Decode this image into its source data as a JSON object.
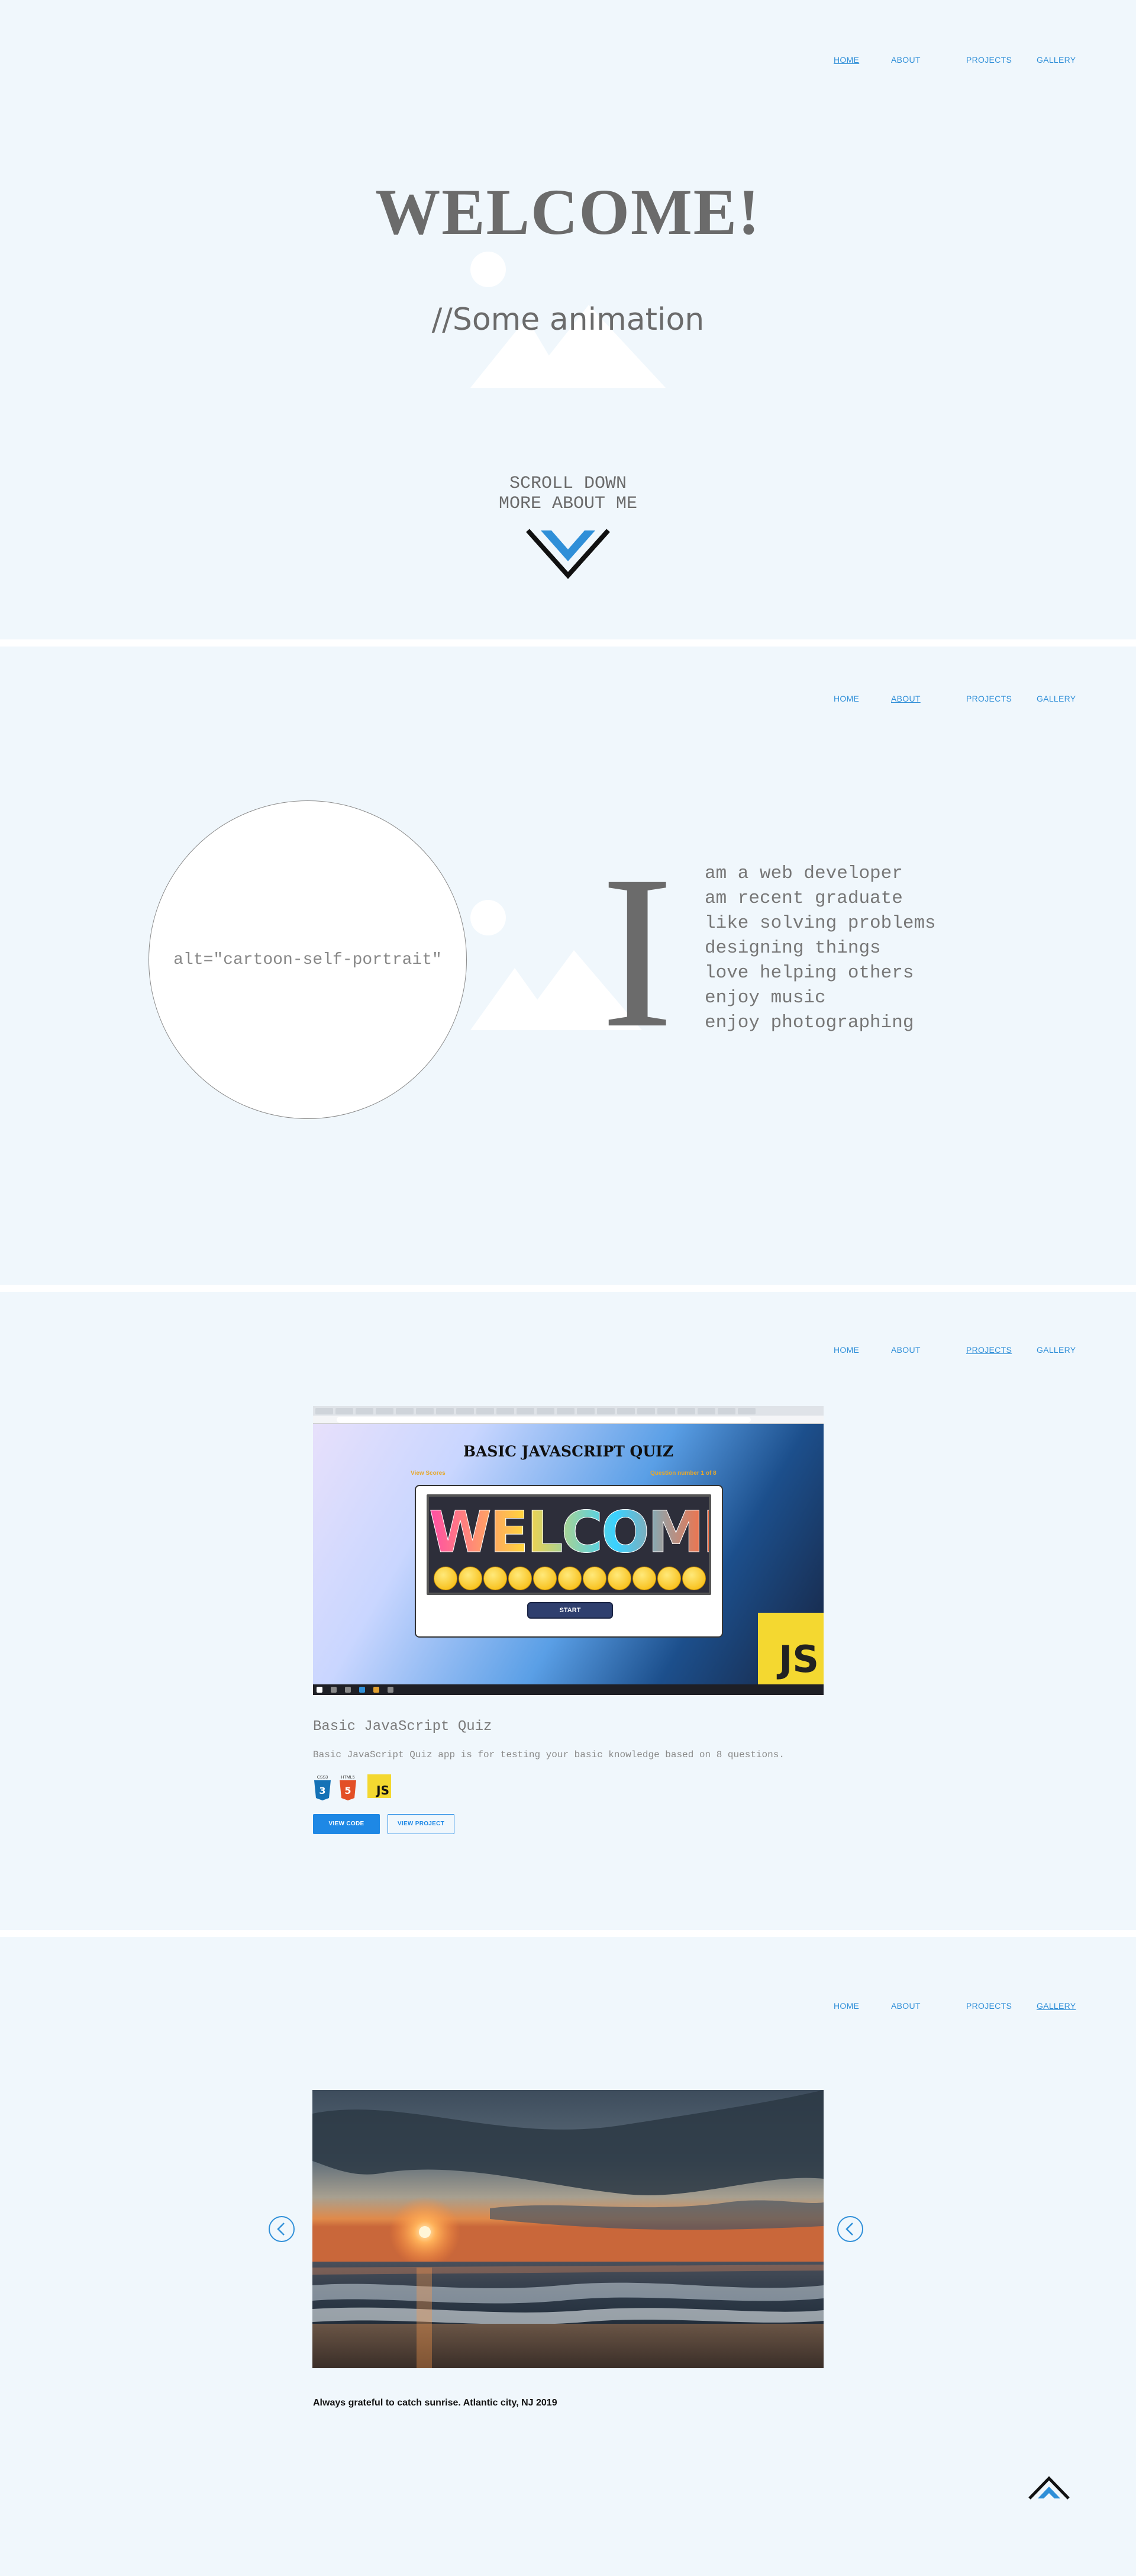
{
  "nav": {
    "home": "HOME",
    "about": "ABOUT",
    "projects": "PROJECTS",
    "gallery": "GALLERY"
  },
  "hero": {
    "title": "WELCOME!",
    "animation_text": "//Some animation",
    "scroll_line1": "SCROLL DOWN",
    "scroll_line2": "MORE ABOUT ME",
    "broken_image_icon": "broken-image-icon",
    "chevron_icon": "chevron-down-icon",
    "accent": "#2f8fd8"
  },
  "about": {
    "portrait_alt": "alt=\"cartoon-self-portrait\"",
    "big_letter": "I",
    "lines": [
      "am a web developer",
      "am recent graduate",
      "like solving problems",
      "designing things",
      "love helping others",
      "enjoy music",
      "enjoy photographing"
    ]
  },
  "projects": {
    "screenshot": {
      "title": "BASIC JAVASCRIPT QUIZ",
      "meta_left": "View Scores",
      "meta_right": "Question number 1 of 8",
      "banner": "WELCOME",
      "start": "START",
      "js_badge": "JS"
    },
    "title": "Basic JavaScript Quiz",
    "description": "Basic JavaScript Quiz app is for testing your basic knowledge based on 8 questions.",
    "tech": {
      "css": "CSS3",
      "html": "HTML5",
      "js": "JS"
    },
    "buttons": {
      "code": "VIEW CODE",
      "project": "VIEW PROJECT"
    }
  },
  "gallery": {
    "caption": "Always grateful to catch sunrise. Atlantic city, NJ 2019",
    "prev_icon": "chevron-left-circle-icon",
    "next_icon": "chevron-right-circle-icon",
    "back_to_top_icon": "chevron-up-icon"
  }
}
